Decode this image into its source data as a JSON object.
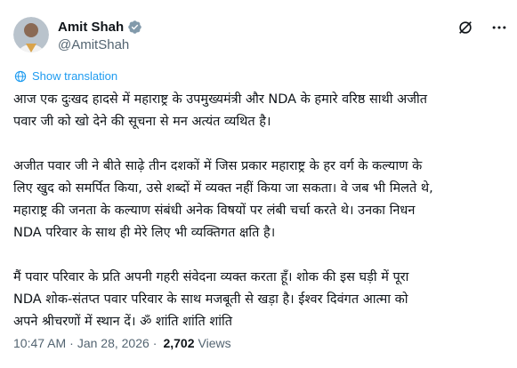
{
  "author": {
    "display_name": "Amit Shah",
    "handle": "@AmitShah",
    "verified_icon": "verified-badge-icon"
  },
  "header_icons": [
    "grok-icon",
    "more-icon"
  ],
  "translate": {
    "label": "Show translation",
    "icon": "globe-icon"
  },
  "tweet": {
    "paragraphs": [
      [
        "आज एक दुःखद हादसे में महाराष्ट्र के उपमुख्यमंत्री और NDA के हमारे वरिष्ठ साथी अजीत",
        "पवार जी को खो देने की सूचना से मन अत्यंत व्यथित है।"
      ],
      [
        "अजीत पवार जी ने बीते साढ़े तीन दशकों में जिस प्रकार महाराष्ट्र के हर वर्ग के कल्याण के",
        "लिए खुद को समर्पित किया, उसे शब्दों में व्यक्त नहीं किया जा सकता। वे जब भी मिलते थे,",
        "महाराष्ट्र की जनता के कल्याण संबंधी अनेक विषयों पर लंबी चर्चा करते थे। उनका निधन",
        "NDA परिवार के साथ ही मेरे लिए भी व्यक्तिगत क्षति है।"
      ],
      [
        "मैं पवार परिवार के प्रति अपनी गहरी संवेदना व्यक्त करता हूँ। शोक की इस घड़ी में पूरा",
        "NDA शोक-संतप्त पवार परिवार के साथ मजबूती से खड़ा है। ईश्वर दिवंगत आत्मा को",
        "अपने श्रीचरणों में स्थान दें। ॐ शांति शांति शांति"
      ]
    ]
  },
  "meta": {
    "time": "10:47 AM",
    "separator": "·",
    "date": "Jan 28, 2026",
    "views_count": "2,702",
    "views_label": "Views"
  },
  "colors": {
    "text": "#0f1419",
    "secondary": "#536471",
    "accent": "#1d9bf0"
  }
}
